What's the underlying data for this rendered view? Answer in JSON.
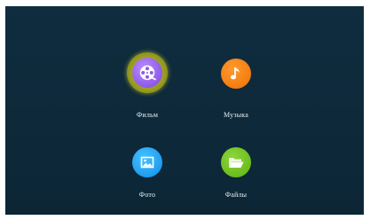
{
  "menu": {
    "items": [
      {
        "label": "Фильм",
        "icon": "film-reel-icon",
        "color": "#8e5ae8",
        "selected": true,
        "highlight": "#9ca021"
      },
      {
        "label": "Музыка",
        "icon": "music-note-icon",
        "color": "#f37d10",
        "selected": false
      },
      {
        "label": "Фото",
        "icon": "picture-icon",
        "color": "#1e9df0",
        "selected": false
      },
      {
        "label": "Файлы",
        "icon": "folder-icon",
        "color": "#6cbd1e",
        "selected": false
      }
    ]
  },
  "theme": {
    "background": "#0e2a3b",
    "label_color": "#e8eef2"
  }
}
